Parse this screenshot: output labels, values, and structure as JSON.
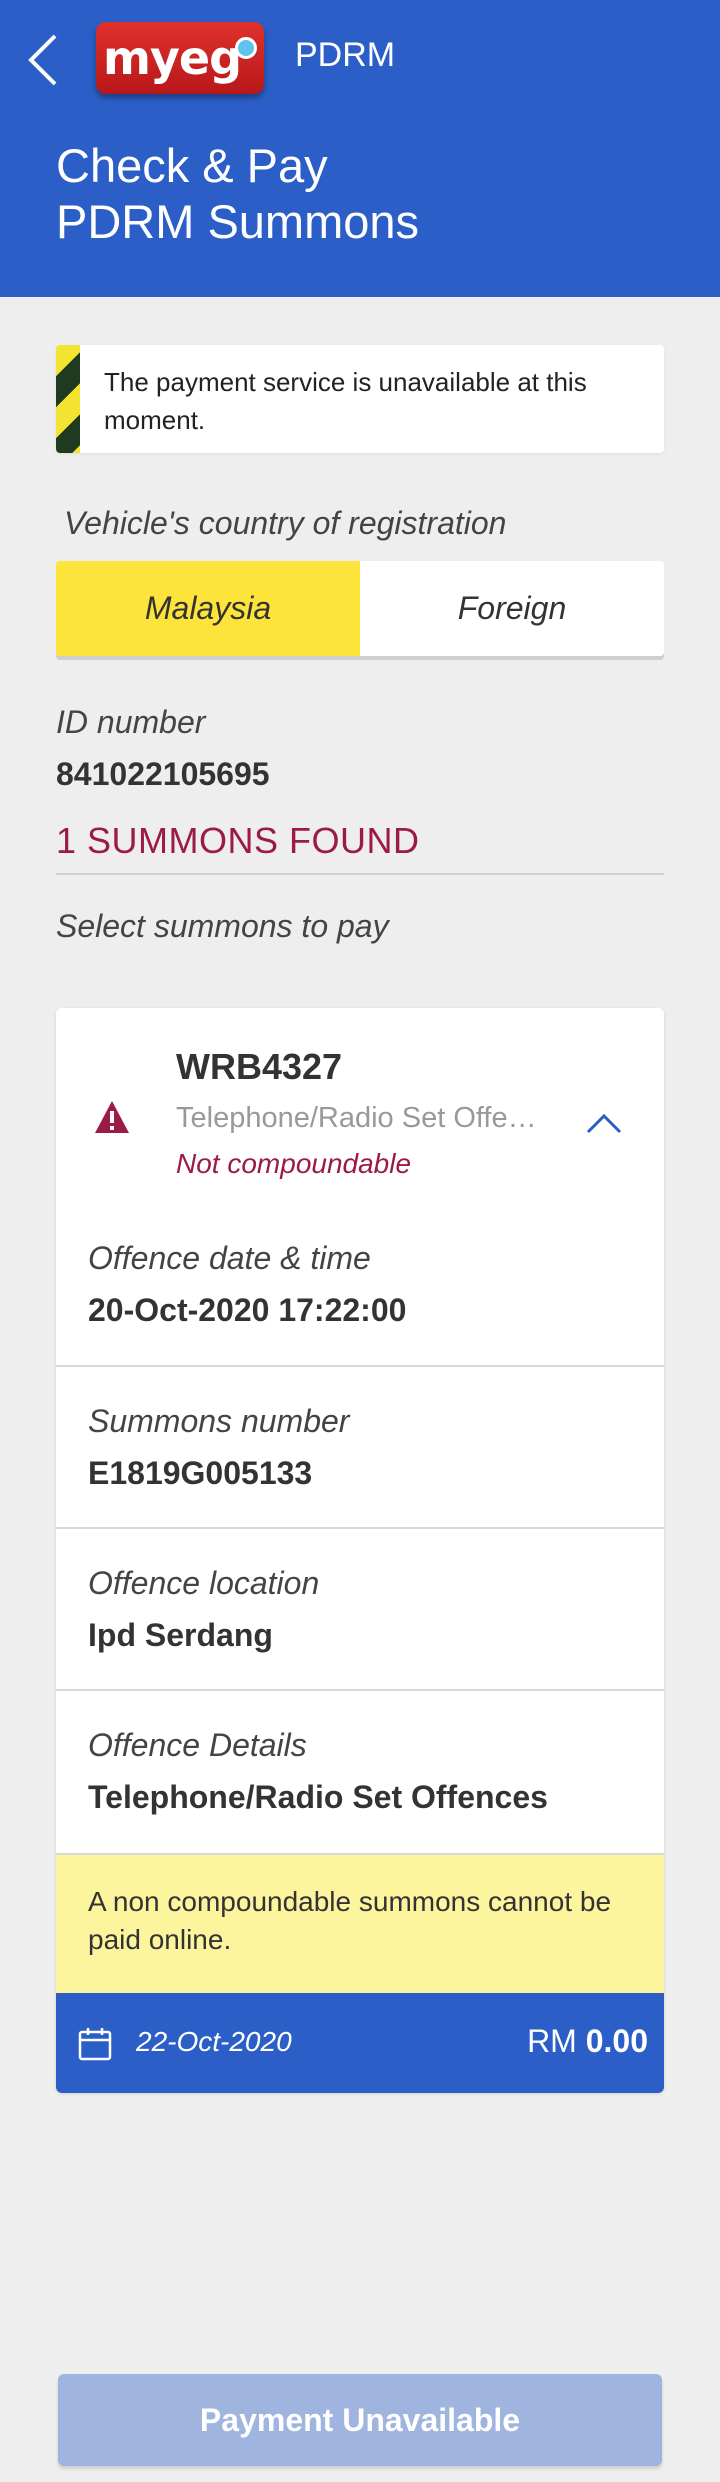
{
  "header": {
    "app_label": "PDRM",
    "logo_text": "myeg",
    "title_line1": "Check & Pay",
    "title_line2": "PDRM Summons"
  },
  "alert": {
    "text": "The payment service is unavailable at this moment."
  },
  "vehicle_registration": {
    "label": "Vehicle's country of registration",
    "options": [
      "Malaysia",
      "Foreign"
    ],
    "selected": "Malaysia"
  },
  "id_info": {
    "label": "ID number",
    "value": "841022105695"
  },
  "summons_found": "1 SUMMONS FOUND",
  "select_prompt": "Select summons to pay",
  "summons": {
    "plate": "WRB4327",
    "offence_short": "Telephone/Radio Set Offences",
    "status": "Not compoundable",
    "details": [
      {
        "label": "Offence date & time",
        "value": "20-Oct-2020 17:22:00"
      },
      {
        "label": "Summons number",
        "value": "E1819G005133"
      },
      {
        "label": "Offence location",
        "value": "Ipd Serdang"
      },
      {
        "label": "Offence Details",
        "value": "Telephone/Radio Set Offences"
      }
    ],
    "notice": "A non compoundable summons cannot be paid online.",
    "footer_date": "22-Oct-2020",
    "currency": "RM",
    "amount": "0.00"
  },
  "pay_button_label": "Payment Unavailable",
  "colors": {
    "primary_blue": "#2b5fc7",
    "accent_yellow": "#fde43a",
    "warning_red": "#9c1b45",
    "notice_yellow": "#fdf49e",
    "disabled_button": "#9fb4df"
  },
  "icons": [
    "back-arrow-icon",
    "warning-triangle-icon",
    "chevron-up-icon",
    "calendar-icon"
  ]
}
